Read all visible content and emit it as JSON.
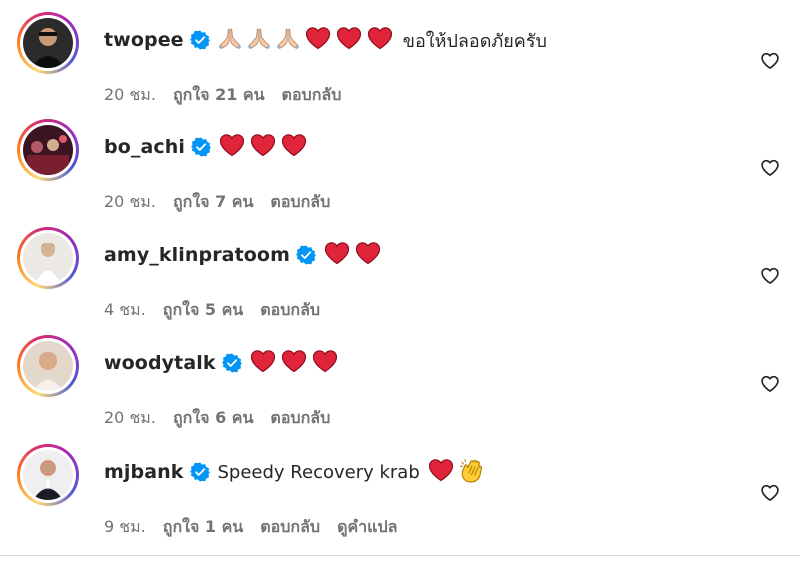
{
  "comments": [
    {
      "username": "twopee",
      "emojis": [
        "pray",
        "pray",
        "pray",
        "red-heart",
        "red-heart",
        "red-heart"
      ],
      "text": "ขอให้ปลอดภัยครับ",
      "time": "20 ชม.",
      "likes": "ถูกใจ 21 คน",
      "reply": "ตอบกลับ",
      "avatar_color": "#1c1c1c"
    },
    {
      "username": "bo_achi",
      "emojis": [
        "red-heart",
        "red-heart",
        "red-heart"
      ],
      "time": "20 ชม.",
      "likes": "ถูกใจ 7 คน",
      "reply": "ตอบกลับ",
      "avatar_color": "#5a1d2c"
    },
    {
      "username": "amy_klinpratoom",
      "emojis": [
        "red-heart",
        "red-heart"
      ],
      "time": "4 ชม.",
      "likes": "ถูกใจ 5 คน",
      "reply": "ตอบกลับ",
      "avatar_color": "#e9e6e2"
    },
    {
      "username": "woodytalk",
      "emojis": [
        "red-heart",
        "red-heart",
        "red-heart"
      ],
      "time": "20 ชม.",
      "likes": "ถูกใจ 6 คน",
      "reply": "ตอบกลับ",
      "avatar_color": "#d9c7b6"
    },
    {
      "username": "mjbank",
      "text": "Speedy Recovery krab",
      "emojis": [
        "red-heart",
        "clapping-hands"
      ],
      "time": "9 ชม.",
      "likes": "ถูกใจ 1 คน",
      "reply": "ตอบกลับ",
      "translate": "ดูคำแปล",
      "avatar_color": "#ececec"
    }
  ],
  "colors": {
    "verified_badge": "#0095f6",
    "username": "#262626",
    "meta_text": "#737373",
    "heart_emoji": "#e0243a",
    "divider": "#dbdbdb"
  }
}
